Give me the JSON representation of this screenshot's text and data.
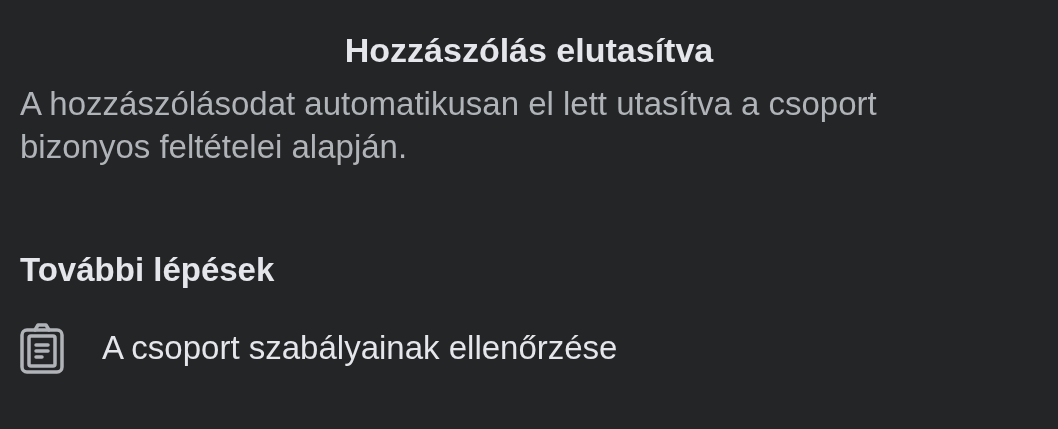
{
  "title": "Hozzászólás elutasítva",
  "message": "A hozzászólásodat automatikusan el lett utasítva a csoport bizonyos feltételei alapján.",
  "next_steps": {
    "heading": "További lépések",
    "items": [
      {
        "label": "A csoport szabályainak ellenőrzése"
      }
    ]
  }
}
